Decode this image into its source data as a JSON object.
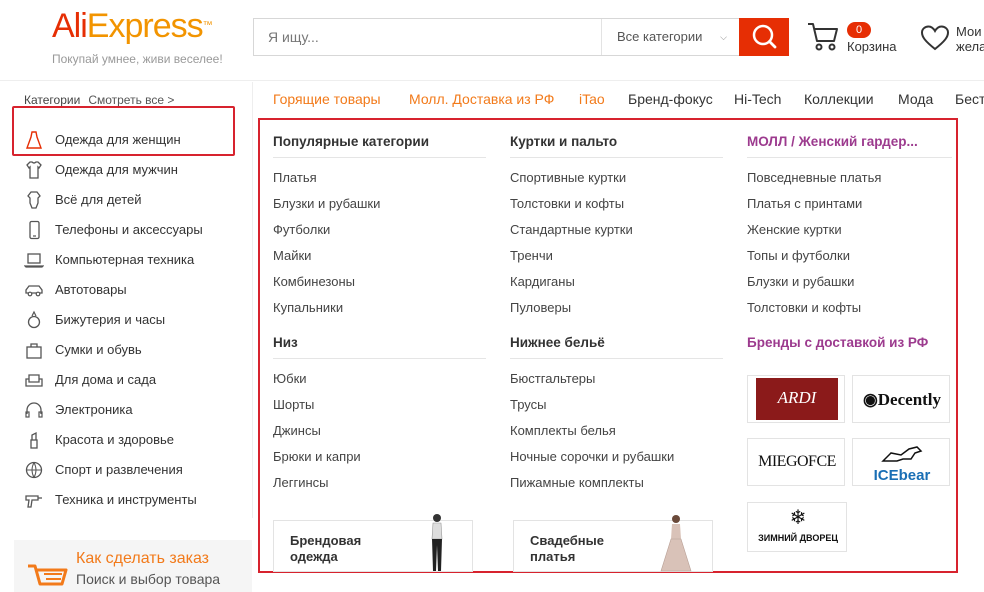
{
  "header": {
    "logo_part1": "Ali",
    "logo_part2": "Express",
    "tagline": "Покупай умнее, живи веселее!",
    "search_placeholder": "Я ищу...",
    "search_category": "Все категории",
    "cart_count": "0",
    "cart_label": "Корзина",
    "wishlist_label_line1": "Мои",
    "wishlist_label_line2": "жела"
  },
  "sidebar": {
    "heading": "Категории",
    "see_all": "Смотреть все >",
    "items": [
      {
        "label": "Одежда для женщин",
        "icon": "dress-icon"
      },
      {
        "label": "Одежда для мужчин",
        "icon": "shirt-icon"
      },
      {
        "label": "Всё для детей",
        "icon": "onesie-icon"
      },
      {
        "label": "Телефоны и аксессуары",
        "icon": "phone-icon"
      },
      {
        "label": "Компьютерная техника",
        "icon": "laptop-icon"
      },
      {
        "label": "Автотовары",
        "icon": "car-icon"
      },
      {
        "label": "Бижутерия и часы",
        "icon": "ring-icon"
      },
      {
        "label": "Сумки и обувь",
        "icon": "bag-icon"
      },
      {
        "label": "Для дома и сада",
        "icon": "sofa-icon"
      },
      {
        "label": "Электроника",
        "icon": "headphones-icon"
      },
      {
        "label": "Красота и здоровье",
        "icon": "lipstick-icon"
      },
      {
        "label": "Спорт и развлечения",
        "icon": "ball-icon"
      },
      {
        "label": "Техника и инструменты",
        "icon": "drill-icon"
      }
    ],
    "promo_title": "Как сделать заказ",
    "promo_sub": "Поиск и выбор товара"
  },
  "nav": {
    "items": [
      "Горящие товары",
      "Молл. Доставка из РФ",
      "iTao",
      "Бренд-фокус",
      "Hi-Tech",
      "Коллекции",
      "Мода",
      "Бест"
    ]
  },
  "dropdown": {
    "col1": {
      "title": "Популярные категории",
      "links": [
        "Платья",
        "Блузки и рубашки",
        "Футболки",
        "Майки",
        "Комбинезоны",
        "Купальники"
      ],
      "title2": "Низ",
      "links2": [
        "Юбки",
        "Шорты",
        "Джинсы",
        "Брюки и капри",
        "Леггинсы"
      ],
      "card_line1": "Брендовая",
      "card_line2": "одежда"
    },
    "col2": {
      "title": "Куртки и пальто",
      "links": [
        "Спортивные куртки",
        "Толстовки и кофты",
        "Стандартные куртки",
        "Тренчи",
        "Кардиганы",
        "Пуловеры"
      ],
      "title2": "Нижнее бельё",
      "links2": [
        "Бюстгальтеры",
        "Трусы",
        "Комплекты белья",
        "Ночные сорочки и рубашки",
        "Пижамные комплекты"
      ],
      "card_line1": "Свадебные",
      "card_line2": "платья"
    },
    "col3": {
      "title": "МОЛЛ / Женский гардер...",
      "links": [
        "Повседневные платья",
        "Платья с принтами",
        "Женские куртки",
        "Топы и футболки",
        "Блузки и рубашки",
        "Толстовки и кофты"
      ],
      "title2": "Бренды с доставкой из РФ",
      "brands": [
        "ARDI",
        "Decently",
        "MIEGOFCE",
        "ICEbear",
        "ЗИМНИЙ ДВОРЕЦ"
      ]
    }
  },
  "colors": {
    "brand_red": "#e62e04",
    "brand_orange": "#f29400",
    "highlight_red": "#d7232e",
    "nav_hot": "#f27a1a",
    "purple": "#9c3a8e"
  }
}
